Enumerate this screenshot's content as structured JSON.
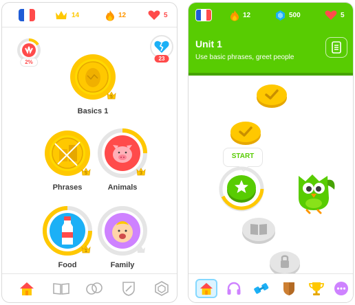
{
  "left_screen": {
    "top_bar": {
      "flag": "france-flag",
      "crowns": "14",
      "streak": "12",
      "hearts": "5"
    },
    "progress_badge": {
      "value": "2%",
      "percent": 2
    },
    "heart_badge": {
      "value": "23"
    },
    "skills": [
      {
        "label": "Basics 1",
        "crown_level": "5",
        "icon": "egg-icon"
      },
      {
        "label": "Phrases",
        "crown_level": "5",
        "icon": "broken-crate-icon"
      },
      {
        "label": "Animals",
        "crown_level": "3",
        "icon": "pig-icon"
      },
      {
        "label": "Food",
        "crown_level": "1",
        "icon": "milk-bottle-icon"
      },
      {
        "label": "Family",
        "crown_level": "",
        "icon": "baby-icon"
      }
    ],
    "bottom_nav": [
      "home-icon",
      "book-icon",
      "characters-icon",
      "shield-icon",
      "hexagon-icon"
    ]
  },
  "right_screen": {
    "top_bar": {
      "flag": "france-flag",
      "streak": "12",
      "gems": "500",
      "hearts": "5"
    },
    "unit": {
      "title": "Unit 1",
      "subtitle": "Use basic phrases, greet people"
    },
    "start_label": "START",
    "bottom_nav": [
      "home-icon",
      "headphones-icon",
      "dumbbell-icon",
      "shield-icon",
      "trophy-icon",
      "more-icon"
    ]
  },
  "colors": {
    "green": "#58cc02",
    "gold": "#ffc800",
    "red": "#ff4b4b",
    "blue": "#1cb0f6",
    "purple": "#ce82ff",
    "gray": "#e5e5e5"
  }
}
